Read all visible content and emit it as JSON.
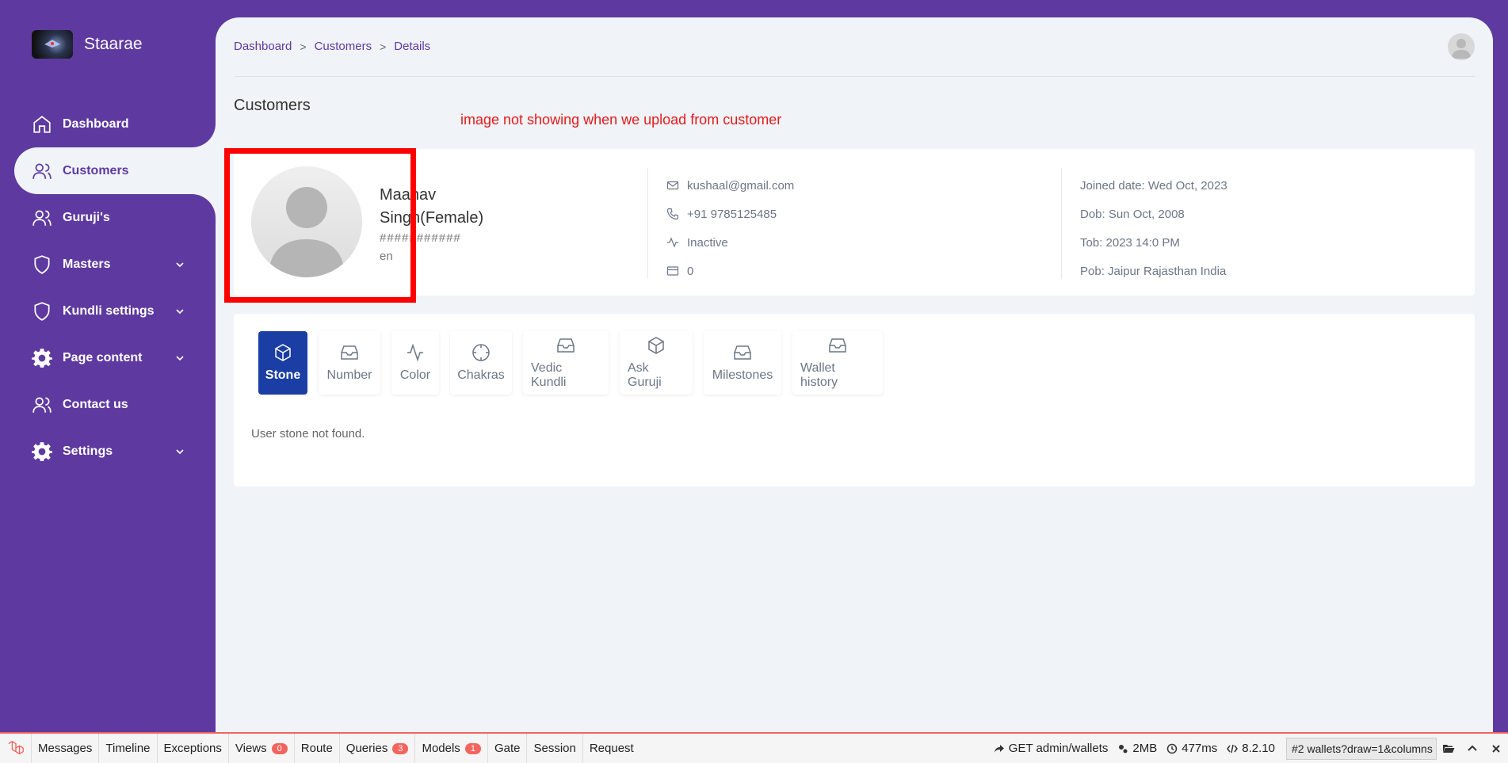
{
  "brand": {
    "name": "Staarae"
  },
  "sidebar": {
    "items": [
      {
        "label": "Dashboard"
      },
      {
        "label": "Customers"
      },
      {
        "label": "Guruji's"
      },
      {
        "label": "Masters"
      },
      {
        "label": "Kundli settings"
      },
      {
        "label": "Page content"
      },
      {
        "label": "Contact us"
      },
      {
        "label": "Settings"
      }
    ]
  },
  "breadcrumb": {
    "items": [
      "Dashboard",
      "Customers",
      "Details"
    ],
    "separator": ">"
  },
  "page": {
    "title": "Customers",
    "annotation": "image not showing when we upload from customer"
  },
  "profile": {
    "name": "Maanav Singh(Female)",
    "id_masked": "###########",
    "language": "en",
    "email": "kushaal@gmail.com",
    "phone": "+91 9785125485",
    "status": "Inactive",
    "wallet": "0",
    "joined": "Joined date: Wed Oct, 2023",
    "dob": "Dob: Sun Oct, 2008",
    "tob": "Tob: 2023 14:0 PM",
    "pob": "Pob: Jaipur Rajasthan India"
  },
  "tabs": [
    {
      "label": "Stone",
      "icon": "box-icon"
    },
    {
      "label": "Number",
      "icon": "inbox-icon"
    },
    {
      "label": "Color",
      "icon": "activity-icon"
    },
    {
      "label": "Chakras",
      "icon": "crosshair-icon"
    },
    {
      "label": "Vedic Kundli",
      "icon": "inbox-icon"
    },
    {
      "label": "Ask Guruji",
      "icon": "box-icon"
    },
    {
      "label": "Milestones",
      "icon": "inbox-icon"
    },
    {
      "label": "Wallet history",
      "icon": "inbox-icon"
    }
  ],
  "tab_content": {
    "empty": "User stone not found."
  },
  "debugbar": {
    "items": [
      {
        "label": "Messages"
      },
      {
        "label": "Timeline"
      },
      {
        "label": "Exceptions"
      },
      {
        "label": "Views",
        "badge": "0"
      },
      {
        "label": "Route"
      },
      {
        "label": "Queries",
        "badge": "3"
      },
      {
        "label": "Models",
        "badge": "1"
      },
      {
        "label": "Gate"
      },
      {
        "label": "Session"
      },
      {
        "label": "Request"
      }
    ],
    "request": "GET admin/wallets",
    "memory": "2MB",
    "time": "477ms",
    "php": "8.2.10",
    "selected_request": "#2 wallets?draw=1&columns"
  },
  "colors": {
    "sidebar": "#5e3aa0",
    "accent_tab": "#1a3ea3",
    "annotation": "#e41b1b",
    "highlight": "#ff0000"
  }
}
